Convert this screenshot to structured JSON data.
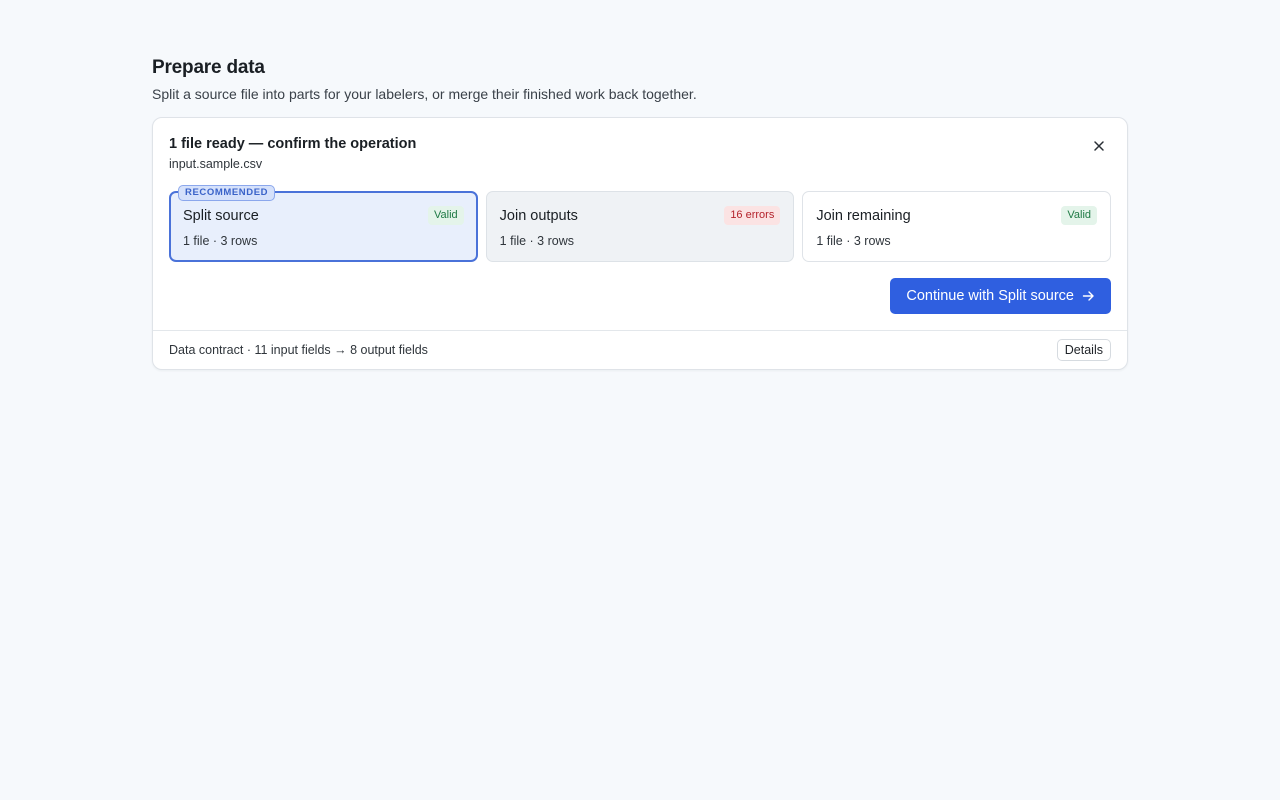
{
  "page": {
    "title": "Prepare data",
    "subtitle": "Split a source file into parts for your labelers, or merge their finished work back together."
  },
  "panel": {
    "heading": "1 file ready — confirm the operation",
    "file_name": "input.sample.csv",
    "close_icon": "close-icon",
    "options": [
      {
        "name": "Split source",
        "meta": "1 file · 3 rows",
        "status": "Valid",
        "status_color": "#1f7a45",
        "tag": "RECOMMENDED",
        "selected": true
      },
      {
        "name": "Join outputs",
        "meta": "1 file · 3 rows",
        "status": "16 errors",
        "status_color": "#b4232c",
        "selected": false
      },
      {
        "name": "Join remaining",
        "meta": "1 file · 3 rows",
        "status": "Valid",
        "status_color": "#1f7a45",
        "selected": false
      }
    ],
    "continue_label": "Continue with Split source",
    "continue_icon": "arrow-right-icon",
    "accent_color": "#2f5fe0"
  },
  "footer": {
    "contract_text": "Data contract · 11 input fields → 8 output fields",
    "details_label": "Details"
  }
}
